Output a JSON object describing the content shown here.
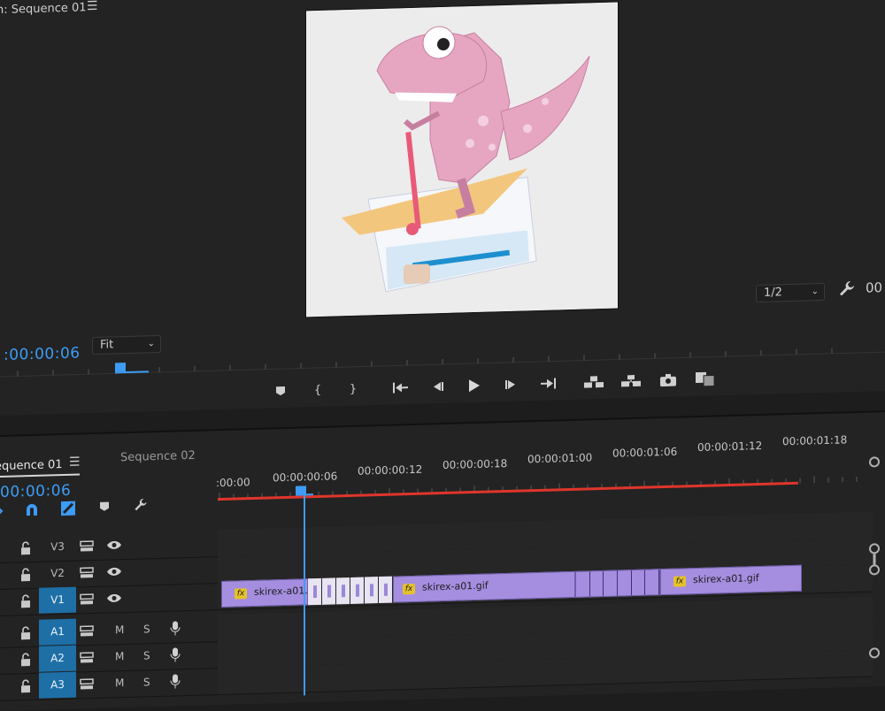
{
  "monitor": {
    "title": "n: Sequence 01",
    "menu_icon": "hamburger-icon",
    "timecode": ":00:00:06",
    "fit_label": "Fit",
    "resolution_label": "1/2",
    "timecode_right": "00",
    "transport": {
      "buttons": [
        "add-marker-icon",
        "mark-in-icon",
        "mark-out-icon",
        "go-to-in-icon",
        "step-back-icon",
        "play-icon",
        "step-forward-icon",
        "go-to-out-icon",
        "lift-icon",
        "extract-icon",
        "export-frame-icon",
        "comparison-view-icon"
      ]
    }
  },
  "timeline": {
    "tab_active": "equence 01",
    "tab_inactive": "Sequence 02",
    "timecode": "00:00:06",
    "ruler_labels": [
      ":00:00",
      "00:00:00:06",
      "00:00:00:12",
      "00:00:00:18",
      "00:00:01:00",
      "00:00:01:06",
      "00:00:01:12",
      "00:00:01:18"
    ],
    "tracks": [
      {
        "name": "V3",
        "type": "video",
        "active": false
      },
      {
        "name": "V2",
        "type": "video",
        "active": false
      },
      {
        "name": "V1",
        "type": "video",
        "active": true
      },
      {
        "name": "A1",
        "type": "audio",
        "active": true
      },
      {
        "name": "A2",
        "type": "audio",
        "active": true
      },
      {
        "name": "A3",
        "type": "audio",
        "active": true
      }
    ],
    "audio_labels": {
      "mute": "M",
      "solo": "S"
    },
    "clips": [
      {
        "label": "skirex-a01.",
        "fx": "fx"
      },
      {
        "label": "skirex-a01.gif",
        "fx": "fx"
      },
      {
        "label": "skirex-a01.gif",
        "fx": "fx"
      }
    ],
    "colors": {
      "clip": "#a58ee0",
      "playhead": "#3d9cf5",
      "work_area": "#e0352b",
      "track_active": "#1e6fa6"
    }
  }
}
